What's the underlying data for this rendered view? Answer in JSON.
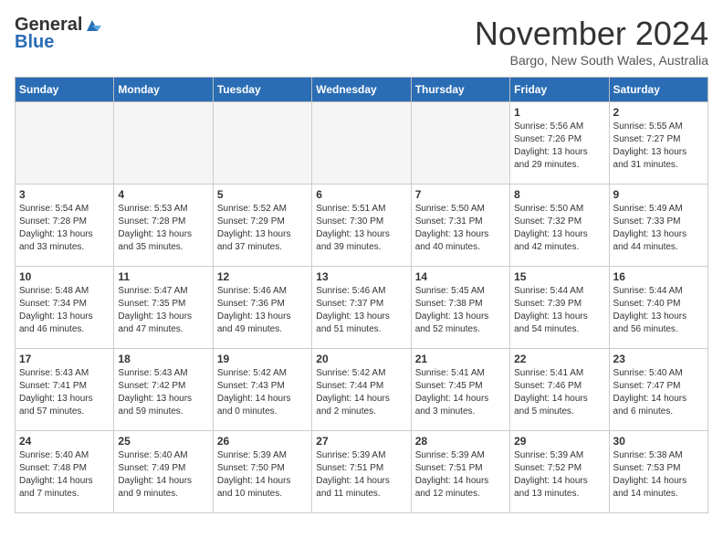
{
  "header": {
    "logo_general": "General",
    "logo_blue": "Blue",
    "month_title": "November 2024",
    "subtitle": "Bargo, New South Wales, Australia"
  },
  "weekdays": [
    "Sunday",
    "Monday",
    "Tuesday",
    "Wednesday",
    "Thursday",
    "Friday",
    "Saturday"
  ],
  "weeks": [
    [
      {
        "day": "",
        "info": "",
        "shaded": true
      },
      {
        "day": "",
        "info": "",
        "shaded": true
      },
      {
        "day": "",
        "info": "",
        "shaded": true
      },
      {
        "day": "",
        "info": "",
        "shaded": true
      },
      {
        "day": "",
        "info": "",
        "shaded": true
      },
      {
        "day": "1",
        "info": "Sunrise: 5:56 AM\nSunset: 7:26 PM\nDaylight: 13 hours\nand 29 minutes.",
        "shaded": false
      },
      {
        "day": "2",
        "info": "Sunrise: 5:55 AM\nSunset: 7:27 PM\nDaylight: 13 hours\nand 31 minutes.",
        "shaded": false
      }
    ],
    [
      {
        "day": "3",
        "info": "Sunrise: 5:54 AM\nSunset: 7:28 PM\nDaylight: 13 hours\nand 33 minutes.",
        "shaded": false
      },
      {
        "day": "4",
        "info": "Sunrise: 5:53 AM\nSunset: 7:28 PM\nDaylight: 13 hours\nand 35 minutes.",
        "shaded": false
      },
      {
        "day": "5",
        "info": "Sunrise: 5:52 AM\nSunset: 7:29 PM\nDaylight: 13 hours\nand 37 minutes.",
        "shaded": false
      },
      {
        "day": "6",
        "info": "Sunrise: 5:51 AM\nSunset: 7:30 PM\nDaylight: 13 hours\nand 39 minutes.",
        "shaded": false
      },
      {
        "day": "7",
        "info": "Sunrise: 5:50 AM\nSunset: 7:31 PM\nDaylight: 13 hours\nand 40 minutes.",
        "shaded": false
      },
      {
        "day": "8",
        "info": "Sunrise: 5:50 AM\nSunset: 7:32 PM\nDaylight: 13 hours\nand 42 minutes.",
        "shaded": false
      },
      {
        "day": "9",
        "info": "Sunrise: 5:49 AM\nSunset: 7:33 PM\nDaylight: 13 hours\nand 44 minutes.",
        "shaded": false
      }
    ],
    [
      {
        "day": "10",
        "info": "Sunrise: 5:48 AM\nSunset: 7:34 PM\nDaylight: 13 hours\nand 46 minutes.",
        "shaded": false
      },
      {
        "day": "11",
        "info": "Sunrise: 5:47 AM\nSunset: 7:35 PM\nDaylight: 13 hours\nand 47 minutes.",
        "shaded": false
      },
      {
        "day": "12",
        "info": "Sunrise: 5:46 AM\nSunset: 7:36 PM\nDaylight: 13 hours\nand 49 minutes.",
        "shaded": false
      },
      {
        "day": "13",
        "info": "Sunrise: 5:46 AM\nSunset: 7:37 PM\nDaylight: 13 hours\nand 51 minutes.",
        "shaded": false
      },
      {
        "day": "14",
        "info": "Sunrise: 5:45 AM\nSunset: 7:38 PM\nDaylight: 13 hours\nand 52 minutes.",
        "shaded": false
      },
      {
        "day": "15",
        "info": "Sunrise: 5:44 AM\nSunset: 7:39 PM\nDaylight: 13 hours\nand 54 minutes.",
        "shaded": false
      },
      {
        "day": "16",
        "info": "Sunrise: 5:44 AM\nSunset: 7:40 PM\nDaylight: 13 hours\nand 56 minutes.",
        "shaded": false
      }
    ],
    [
      {
        "day": "17",
        "info": "Sunrise: 5:43 AM\nSunset: 7:41 PM\nDaylight: 13 hours\nand 57 minutes.",
        "shaded": false
      },
      {
        "day": "18",
        "info": "Sunrise: 5:43 AM\nSunset: 7:42 PM\nDaylight: 13 hours\nand 59 minutes.",
        "shaded": false
      },
      {
        "day": "19",
        "info": "Sunrise: 5:42 AM\nSunset: 7:43 PM\nDaylight: 14 hours\nand 0 minutes.",
        "shaded": false
      },
      {
        "day": "20",
        "info": "Sunrise: 5:42 AM\nSunset: 7:44 PM\nDaylight: 14 hours\nand 2 minutes.",
        "shaded": false
      },
      {
        "day": "21",
        "info": "Sunrise: 5:41 AM\nSunset: 7:45 PM\nDaylight: 14 hours\nand 3 minutes.",
        "shaded": false
      },
      {
        "day": "22",
        "info": "Sunrise: 5:41 AM\nSunset: 7:46 PM\nDaylight: 14 hours\nand 5 minutes.",
        "shaded": false
      },
      {
        "day": "23",
        "info": "Sunrise: 5:40 AM\nSunset: 7:47 PM\nDaylight: 14 hours\nand 6 minutes.",
        "shaded": false
      }
    ],
    [
      {
        "day": "24",
        "info": "Sunrise: 5:40 AM\nSunset: 7:48 PM\nDaylight: 14 hours\nand 7 minutes.",
        "shaded": false
      },
      {
        "day": "25",
        "info": "Sunrise: 5:40 AM\nSunset: 7:49 PM\nDaylight: 14 hours\nand 9 minutes.",
        "shaded": false
      },
      {
        "day": "26",
        "info": "Sunrise: 5:39 AM\nSunset: 7:50 PM\nDaylight: 14 hours\nand 10 minutes.",
        "shaded": false
      },
      {
        "day": "27",
        "info": "Sunrise: 5:39 AM\nSunset: 7:51 PM\nDaylight: 14 hours\nand 11 minutes.",
        "shaded": false
      },
      {
        "day": "28",
        "info": "Sunrise: 5:39 AM\nSunset: 7:51 PM\nDaylight: 14 hours\nand 12 minutes.",
        "shaded": false
      },
      {
        "day": "29",
        "info": "Sunrise: 5:39 AM\nSunset: 7:52 PM\nDaylight: 14 hours\nand 13 minutes.",
        "shaded": false
      },
      {
        "day": "30",
        "info": "Sunrise: 5:38 AM\nSunset: 7:53 PM\nDaylight: 14 hours\nand 14 minutes.",
        "shaded": false
      }
    ]
  ]
}
